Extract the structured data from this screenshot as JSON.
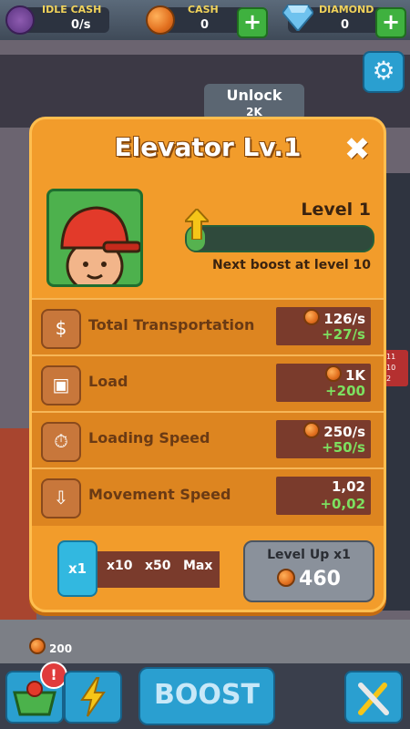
{
  "topbar": {
    "idle_cash": {
      "label": "IDLE CASH",
      "value": "0/s"
    },
    "cash": {
      "label": "CASH",
      "value": "0"
    },
    "diamond": {
      "label": "DIAMOND",
      "value": "0"
    },
    "plus_symbol": "+"
  },
  "background": {
    "unlock_label": "Unlock",
    "unlock_cost": "2K",
    "street_coins": "200",
    "side_counts": [
      "11",
      "10",
      "2"
    ]
  },
  "modal": {
    "title": "Elevator Lv.1",
    "close_symbol": "✖",
    "level_label": "Level 1",
    "progress": 0.1,
    "next_boost_text": "Next boost at level 10",
    "stats": [
      {
        "name": "Total Transportation",
        "value": "126/s",
        "increase": "+27/s",
        "icon": "cash-tray-icon",
        "glyph": "$",
        "show_coin": true
      },
      {
        "name": "Load",
        "value": "1K",
        "increase": "+200",
        "icon": "load-icon",
        "glyph": "▣",
        "show_coin": true
      },
      {
        "name": "Loading Speed",
        "value": "250/s",
        "increase": "+50/s",
        "icon": "loading-speed-icon",
        "glyph": "⏱",
        "show_coin": true
      },
      {
        "name": "Movement Speed",
        "value": "1,02",
        "increase": "+0,02",
        "icon": "movement-speed-icon",
        "glyph": "⇩",
        "show_coin": false
      }
    ],
    "multipliers": [
      "x1",
      "x10",
      "x50",
      "Max"
    ],
    "active_multiplier": "x1",
    "level_up_label": "Level Up x1",
    "level_up_cost": "460"
  },
  "bottom_bar": {
    "boost_label": "BOOST",
    "alert_symbol": "!"
  },
  "colors": {
    "modal_orange": "#f29c2b",
    "stat_box": "#7a3b2c",
    "increase_green": "#7de060",
    "active_blue": "#32b8e0"
  }
}
